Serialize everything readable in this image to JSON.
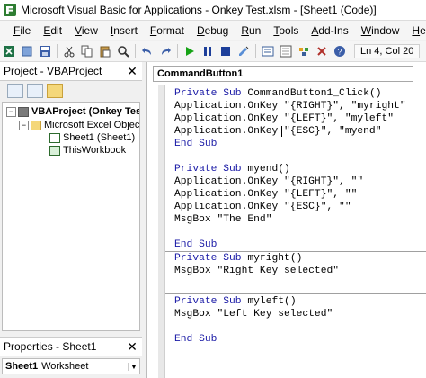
{
  "window": {
    "title": "Microsoft Visual Basic for Applications - Onkey Test.xlsm - [Sheet1 (Code)]"
  },
  "menu": {
    "items": [
      "File",
      "Edit",
      "View",
      "Insert",
      "Format",
      "Debug",
      "Run",
      "Tools",
      "Add-Ins",
      "Window",
      "Help"
    ]
  },
  "toolbar": {
    "status": "Ln 4, Col 20"
  },
  "project": {
    "title": "Project - VBAProject",
    "tree": {
      "root": "VBAProject (Onkey Test",
      "folder": "Microsoft Excel Objects",
      "sheet": "Sheet1 (Sheet1)",
      "workbook": "ThisWorkbook"
    }
  },
  "properties": {
    "title": "Properties - Sheet1",
    "object_name": "Sheet1",
    "object_type": "Worksheet"
  },
  "code": {
    "object_combo": "CommandButton1",
    "lines": [
      {
        "kw": "Private Sub ",
        "rest": "CommandButton1_Click()"
      },
      {
        "kw": "",
        "rest": "Application.OnKey \"{RIGHT}\", \"myright\""
      },
      {
        "kw": "",
        "rest": "Application.OnKey \"{LEFT}\", \"myleft\""
      },
      {
        "kw": "",
        "rest": "Application.OnKey \"{ESC}\", \"myend\""
      },
      {
        "kw": "End Sub",
        "rest": ""
      },
      {
        "kw": "Private Sub ",
        "rest": "myend()"
      },
      {
        "kw": "",
        "rest": "Application.OnKey \"{RIGHT}\", \"\""
      },
      {
        "kw": "",
        "rest": "Application.OnKey \"{LEFT}\", \"\""
      },
      {
        "kw": "",
        "rest": "Application.OnKey \"{ESC}\", \"\""
      },
      {
        "kw": "",
        "rest": "MsgBox \"The End\""
      },
      {
        "kw": "End Sub",
        "rest": ""
      },
      {
        "kw": "Private Sub ",
        "rest": "myright()"
      },
      {
        "kw": "",
        "rest": "MsgBox \"Right Key selected\""
      },
      {
        "kw": "Private Sub ",
        "rest": "myleft()"
      },
      {
        "kw": "",
        "rest": "MsgBox \"Left Key selected\""
      },
      {
        "kw": "End Sub",
        "rest": ""
      }
    ]
  },
  "colors": {
    "keyword": "#1a1aa6",
    "run": "#16a316",
    "stop": "#1d3f9a"
  },
  "icons": [
    "vba-app-icon",
    "excel-icon",
    "save-icon",
    "cut-icon",
    "copy-icon",
    "paste-icon",
    "find-icon",
    "undo-icon",
    "redo-icon",
    "run-icon",
    "break-icon",
    "reset-icon",
    "design-mode-icon",
    "project-explorer-icon",
    "properties-icon",
    "object-browser-icon",
    "toolbox-icon",
    "help-icon"
  ]
}
